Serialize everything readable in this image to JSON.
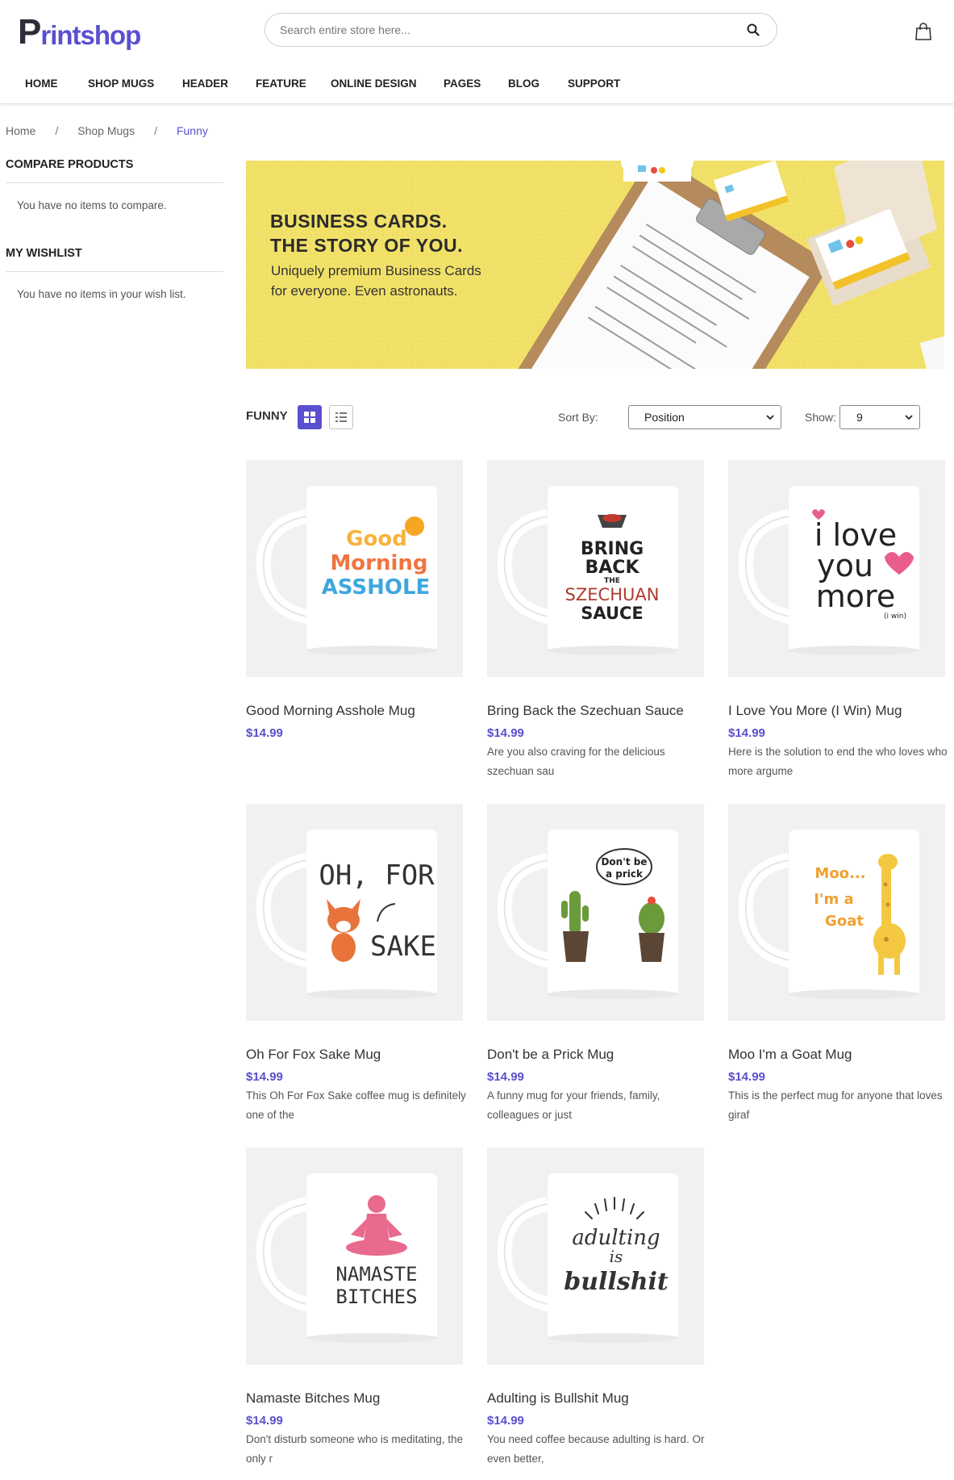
{
  "header": {
    "logo_initial": "P",
    "logo_rest": "rintshop",
    "search_placeholder": "Search entire store here...",
    "nav": [
      "HOME",
      "SHOP MUGS",
      "HEADER",
      "FEATURE",
      "ONLINE DESIGN",
      "PAGES",
      "BLOG",
      "SUPPORT"
    ]
  },
  "breadcrumb": {
    "items": [
      "Home",
      "Shop Mugs"
    ],
    "separator": "/",
    "current": "Funny"
  },
  "sidebar": {
    "compare_title": "COMPARE PRODUCTS",
    "compare_text": "You have no items to compare.",
    "wishlist_title": "MY WISHLIST",
    "wishlist_text": "You have no items in your wish list."
  },
  "banner": {
    "headline_1": "BUSINESS CARDS.",
    "headline_2": "THE STORY OF YOU.",
    "text_1": "Uniquely premium Business Cards",
    "text_2": "for everyone. Even astronauts."
  },
  "toolbar": {
    "category": "FUNNY",
    "sort_label": "Sort By:",
    "sort_value": "Position",
    "show_label": "Show:",
    "show_value": "9"
  },
  "products": [
    {
      "name": "Good Morning Asshole Mug",
      "price": "$14.99",
      "desc": "",
      "art": [
        "Good",
        "Morning",
        "ASSHOLE"
      ]
    },
    {
      "name": "Bring Back the Szechuan Sauce",
      "price": "$14.99",
      "desc": "Are you also craving for the delicious szechuan sau",
      "art": [
        "BRING",
        "BACK",
        "THE",
        "SZECHUAN",
        "SAUCE"
      ]
    },
    {
      "name": "I Love You More (I Win) Mug",
      "price": "$14.99",
      "desc": "Here is the solution to end the who loves who more argume",
      "art": [
        "i love",
        "you",
        "more",
        "(i win)"
      ]
    },
    {
      "name": "Oh For Fox Sake Mug",
      "price": "$14.99",
      "desc": "This Oh For Fox Sake coffee mug is definitely one of the",
      "art": [
        "OH, FOR",
        "SAKE"
      ]
    },
    {
      "name": "Don't be a Prick Mug",
      "price": "$14.99",
      "desc": "A funny mug for your friends, family, colleagues or just",
      "art": [
        "Don't be",
        "a prick"
      ]
    },
    {
      "name": "Moo I'm a Goat Mug",
      "price": "$14.99",
      "desc": "This is the perfect mug for anyone that loves giraf",
      "art": [
        "Moo...",
        "I'm a",
        "Goat"
      ]
    },
    {
      "name": "Namaste Bitches Mug",
      "price": "$14.99",
      "desc": "Don't disturb someone who is meditating, the only r",
      "art": [
        "NAMASTE",
        "BITCHES"
      ]
    },
    {
      "name": "Adulting is Bullshit Mug",
      "price": "$14.99",
      "desc": "You need coffee because adulting is hard. Or even better,",
      "art": [
        "adulting",
        "is",
        "bullshit"
      ]
    }
  ],
  "colors": {
    "accent": "#5a4fcf",
    "banner_bg": "#f1e168",
    "tile_bg": "#f2f1ef"
  }
}
